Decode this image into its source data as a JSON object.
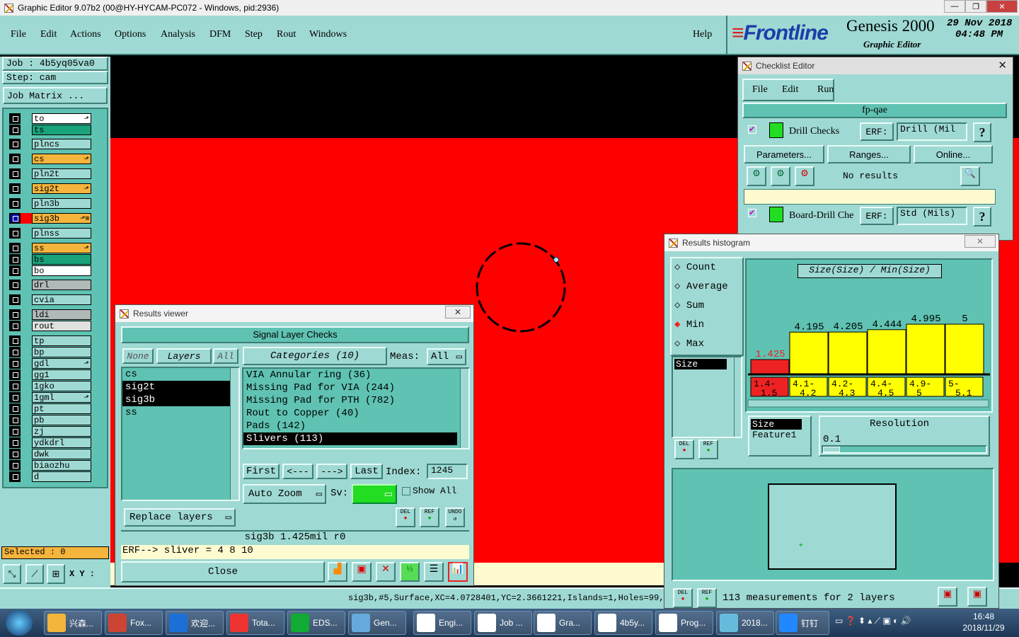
{
  "window": {
    "title": "Graphic Editor 9.07b2 (00@HY-HYCAM-PC072 - Windows, pid:2936)"
  },
  "menu": {
    "items": [
      "File",
      "Edit",
      "Actions",
      "Options",
      "Analysis",
      "DFM",
      "Step",
      "Rout",
      "Windows"
    ],
    "help": "Help"
  },
  "brand": {
    "logo": "Frontline",
    "product": "Genesis 2000",
    "subtitle": "Graphic Editor",
    "date": "29 Nov 2018",
    "time": "04:48 PM"
  },
  "job": {
    "job": "Job  : 4b5yq05va0",
    "step": "Step: cam",
    "matrix_btn": "Job Matrix ...",
    "selected": "Selected : 0",
    "xy": "X Y :"
  },
  "layers": [
    {
      "name": "to",
      "color": "#ffffff",
      "mark": "⬏"
    },
    {
      "name": "ts",
      "color": "#1aa37a",
      "mark": ""
    },
    {
      "name": "plncs",
      "color": "#9fd9d3",
      "mark": ""
    },
    {
      "name": "cs",
      "color": "#f5b43c",
      "mark": "⬏"
    },
    {
      "name": "pln2t",
      "color": "#9fd9d3",
      "mark": ""
    },
    {
      "name": "sig2t",
      "color": "#f5b43c",
      "mark": "⬏"
    },
    {
      "name": "pln3b",
      "color": "#9fd9d3",
      "mark": ""
    },
    {
      "name": "sig3b",
      "color": "#f5b43c",
      "mark": "⬏⊞"
    },
    {
      "name": "plnss",
      "color": "#9fd9d3",
      "mark": ""
    },
    {
      "name": "ss",
      "color": "#f5b43c",
      "mark": "⬏"
    },
    {
      "name": "bs",
      "color": "#1aa37a",
      "mark": ""
    },
    {
      "name": "bo",
      "color": "#ffffff",
      "mark": ""
    },
    {
      "name": "drl",
      "color": "#b0b8b8",
      "mark": ""
    },
    {
      "name": "cvia",
      "color": "#9fd9d3",
      "mark": ""
    },
    {
      "name": "ldi",
      "color": "#b0b8b8",
      "mark": ""
    },
    {
      "name": "rout",
      "color": "#e0e0e0",
      "mark": ""
    },
    {
      "name": "tp",
      "color": "#9fd9d3",
      "mark": ""
    },
    {
      "name": "bp",
      "color": "#9fd9d3",
      "mark": ""
    },
    {
      "name": "gdl",
      "color": "#9fd9d3",
      "mark": "⬏"
    },
    {
      "name": "gg1",
      "color": "#9fd9d3",
      "mark": ""
    },
    {
      "name": "1gko",
      "color": "#9fd9d3",
      "mark": ""
    },
    {
      "name": "1gml",
      "color": "#9fd9d3",
      "mark": "⬏"
    },
    {
      "name": "pt",
      "color": "#9fd9d3",
      "mark": ""
    },
    {
      "name": "pb",
      "color": "#9fd9d3",
      "mark": ""
    },
    {
      "name": "zj",
      "color": "#9fd9d3",
      "mark": ""
    },
    {
      "name": "ydkdrl",
      "color": "#9fd9d3",
      "mark": ""
    },
    {
      "name": "dwk",
      "color": "#9fd9d3",
      "mark": ""
    },
    {
      "name": "biaozhu",
      "color": "#9fd9d3",
      "mark": ""
    },
    {
      "name": "d",
      "color": "#9fd9d3",
      "mark": ""
    }
  ],
  "results_viewer": {
    "title": "Results viewer",
    "header": "Signal Layer Checks",
    "none_btn": "None",
    "layers_btn": "Layers",
    "all_btn": "All",
    "categories_btn": "Categories (10)",
    "meas_label": "Meas:",
    "meas_value": "All",
    "layer_list": [
      "cs",
      "sig2t",
      "sig3b",
      "ss"
    ],
    "categories": [
      "VIA Annular ring (36)",
      "Missing Pad for VIA (244)",
      "Missing Pad for PTH (782)",
      "Rout to Copper (40)",
      "Pads (142)",
      "Slivers (113)"
    ],
    "first": "First",
    "prev": "<---",
    "next": "--->",
    "last": "Last",
    "index_label": "Index:",
    "index_value": "1245",
    "auto_zoom": "Auto Zoom",
    "sv_label": "Sv:",
    "show_all": "Show All",
    "replace": "Replace layers",
    "status": "sig3b 1.425mil  r0",
    "erf": "ERF--> sliver = 4 8 10",
    "close": "Close",
    "del": "DEL",
    "ref": "REF",
    "undo": "UNDO"
  },
  "checklist": {
    "title": "Checklist Editor",
    "menu": [
      "File",
      "Edit",
      "Run"
    ],
    "name": "fp-qae",
    "check1": {
      "name": "Drill Checks",
      "erf": "ERF:",
      "erf_value": "Drill (Mil",
      "help": "?"
    },
    "params": "Parameters...",
    "ranges": "Ranges...",
    "online": "Online...",
    "no_results": "No results",
    "check2": {
      "name": "Board-Drill Che",
      "erf": "ERF:",
      "erf_value": "Std (Mils)",
      "help": "?"
    }
  },
  "histogram": {
    "title": "Results histogram",
    "modes": [
      "Count",
      "Average",
      "Sum",
      "Min",
      "Max"
    ],
    "selected_mode": "Min",
    "field": "Size",
    "chart_title": "Size(Size) / Min(Size)",
    "resolution_label": "Resolution",
    "resolution": "0.1",
    "fields": [
      "Size",
      "Feature1"
    ],
    "summary": "113 measurements for 2 layers",
    "del": "DEL",
    "ref": "REF"
  },
  "chart_data": {
    "type": "bar",
    "title": "Size(Size) / Min(Size)",
    "categories": [
      "1.4-1.5",
      "4.1-4.2",
      "4.2-4.3",
      "4.4-4.5",
      "4.9-5",
      "5-5.1"
    ],
    "values": [
      1.425,
      4.195,
      4.205,
      4.444,
      4.995,
      5
    ],
    "value_labels": [
      "1.425",
      "4.195",
      "4.205",
      "4.444",
      "4.995",
      "5"
    ],
    "ylim": [
      0,
      5
    ],
    "colors": {
      "first": "#ee2222",
      "rest": "#ffff00"
    }
  },
  "status_line": "sig3b,#5,Surface,XC=4.0728401,YC=2.3661221,Islands=1,Holes=99,Pe",
  "taskbar": {
    "items": [
      "兴森...",
      "Fox...",
      "欢迎...",
      "Tota...",
      "EDS...",
      "Gen...",
      "Engi...",
      "Job ...",
      "Gra...",
      "4b5y...",
      "Prog...",
      "2018...",
      "钉钉"
    ],
    "time": "16:48",
    "date": "2018/11/29"
  }
}
